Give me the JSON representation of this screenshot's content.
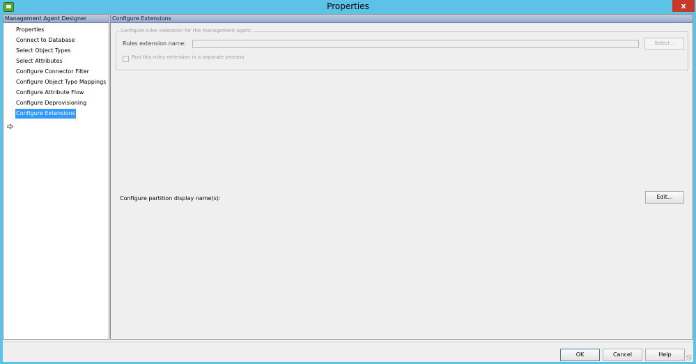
{
  "window": {
    "title": "Properties",
    "close_glyph": "x"
  },
  "left_pane": {
    "header": "Management Agent Designer",
    "items": [
      {
        "label": "Properties"
      },
      {
        "label": "Connect to Database"
      },
      {
        "label": "Select Object Types"
      },
      {
        "label": "Select Attributes"
      },
      {
        "label": "Configure Connector Filter"
      },
      {
        "label": "Configure Object Type Mappings"
      },
      {
        "label": "Configure Attribute Flow"
      },
      {
        "label": "Configure Deprovisioning"
      },
      {
        "label": "Configure Extensions"
      }
    ],
    "selected_index": 8,
    "selection_color": "#3399ff"
  },
  "right_pane": {
    "header": "Configure Extensions",
    "group": {
      "legend": "Configure rules extension for the management agent",
      "rules_label": "Rules extension name:",
      "rules_value": "",
      "select_button": "Select...",
      "checkbox_label": "Run this rules extension in a separate process",
      "checkbox_checked": false
    },
    "partition_label": "Configure partition display name(s):",
    "edit_button": "Edit..."
  },
  "buttons": {
    "ok": "OK",
    "cancel": "Cancel",
    "help": "Help"
  },
  "colors": {
    "titlebar": "#5cc3e6",
    "close_button": "#c7392b",
    "header_gradient_top": "#c2cde2",
    "header_gradient_bottom": "#99a9c9"
  },
  "icons": {
    "app": "app-icon",
    "close": "close-icon",
    "current_step": "arrow-right-icon",
    "resize": "resize-grip-icon"
  }
}
